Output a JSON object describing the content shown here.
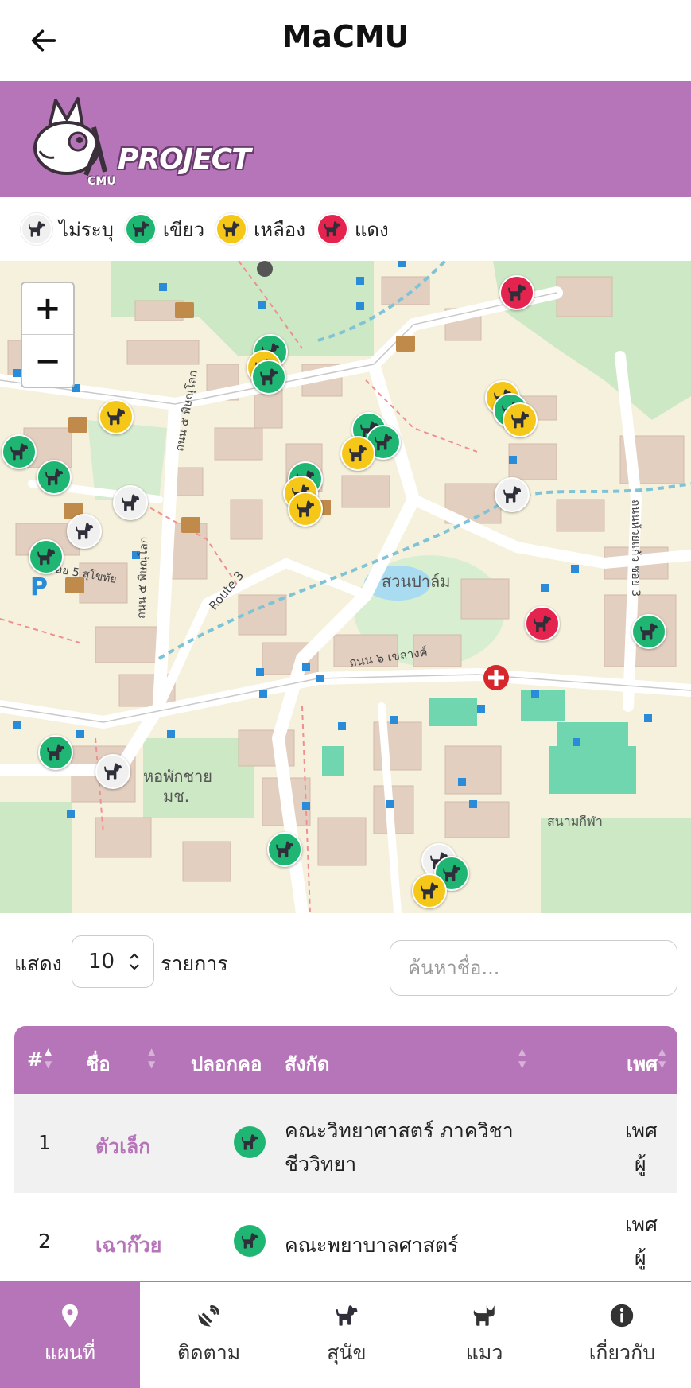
{
  "app": {
    "title": "MaCMU"
  },
  "banner": {
    "logo_text": "PROJECT",
    "logo_sub": "CMU"
  },
  "legend": [
    {
      "label": "ไม่ระบุ",
      "color": "#f2f2f2",
      "icon": "dog-icon"
    },
    {
      "label": "เขียว",
      "color": "#1fb673",
      "icon": "dog-icon"
    },
    {
      "label": "เหลือง",
      "color": "#f5c718",
      "icon": "dog-icon"
    },
    {
      "label": "แดง",
      "color": "#e5234f",
      "icon": "dog-icon"
    }
  ],
  "map": {
    "zoom_in": "+",
    "zoom_out": "−",
    "labels": {
      "park": "สวนปาล์ม",
      "dorm": "หอพักชาย",
      "dorm2": "มช.",
      "route": "Route 3",
      "road1": "ถนน ๕ พิษณุโลก",
      "road2": "ถนน ๕ พิษณุโลก",
      "road3": "ถนน ๖ เขลางค์",
      "road4": "ถนนห้วยแก้ว ซอย 3",
      "soi": "ซอย 5 สุโขทัย",
      "stadium": "สนามกีฬา",
      "parking": "P"
    }
  },
  "controls": {
    "show_label": "แสดง",
    "page_length": "10",
    "items_label": "รายการ",
    "search_placeholder": "ค้นหาชื่อ..."
  },
  "table": {
    "headers": {
      "num": "#",
      "name": "ชื่อ",
      "collar": "ปลอกคอ",
      "affiliation": "สังกัด",
      "sex": "เพศ"
    },
    "rows": [
      {
        "num": "1",
        "name": "ตัวเล็ก",
        "collar": "#1fb673",
        "affiliation_1": "คณะวิทยาศาสตร์ ภาควิชา",
        "affiliation_2": "ชีววิทยา",
        "sex_1": "เพศ",
        "sex_2": "ผู้"
      },
      {
        "num": "2",
        "name": "เฉาก๊วย",
        "collar": "#1fb673",
        "affiliation_1": "คณะพยาบาลศาสตร์",
        "affiliation_2": "",
        "sex_1": "เพศ",
        "sex_2": "ผู้"
      }
    ]
  },
  "nav": [
    {
      "label": "แผนที่",
      "icon": "map-pin-icon",
      "active": true
    },
    {
      "label": "ติดตาม",
      "icon": "satellite-icon",
      "active": false
    },
    {
      "label": "สุนัข",
      "icon": "dog-icon",
      "active": false
    },
    {
      "label": "แมว",
      "icon": "cat-icon",
      "active": false
    },
    {
      "label": "เกี่ยวกับ",
      "icon": "info-icon",
      "active": false
    }
  ]
}
